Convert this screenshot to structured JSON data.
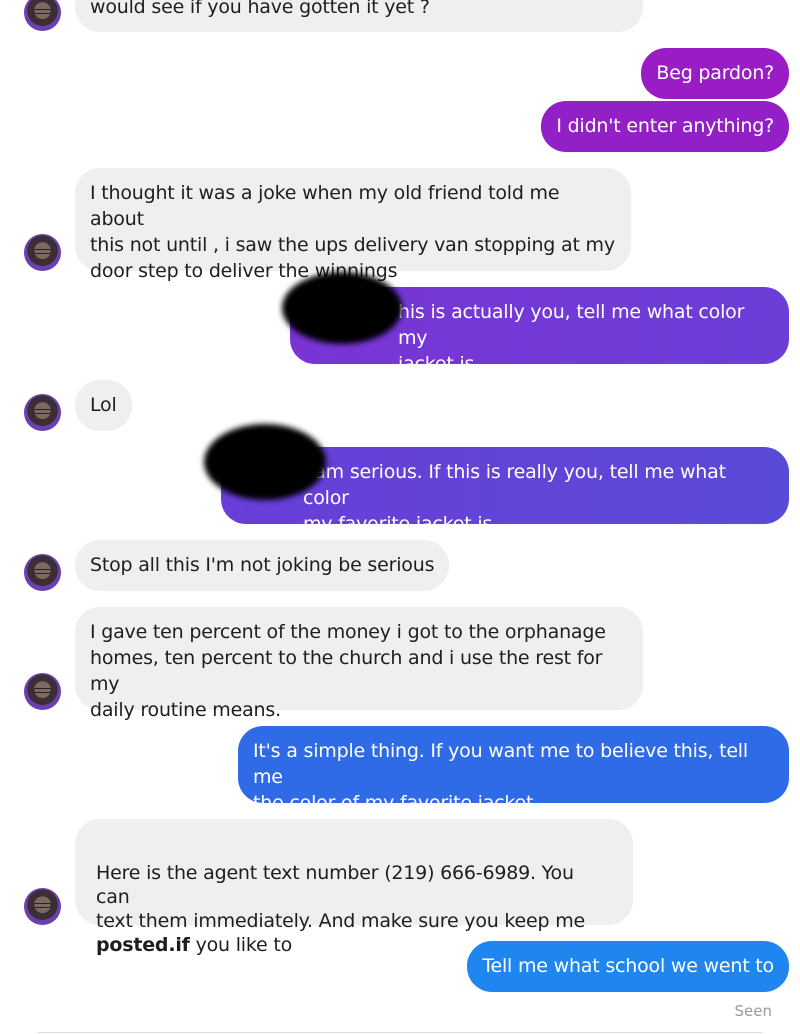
{
  "conversation": {
    "messages": [
      {
        "from": "them",
        "text": "would see if you have gotten it yet ?"
      },
      {
        "from": "me",
        "text": "Beg pardon?"
      },
      {
        "from": "me",
        "text": "I didn't enter anything?"
      },
      {
        "from": "them",
        "text": "I thought it was a joke when my old friend told me about\nthis not until , i saw the ups delivery van stopping at my\ndoor step to deliver the winnings"
      },
      {
        "from": "me",
        "text": "his is actually you, tell me what color my\njacket is."
      },
      {
        "from": "them",
        "text": "Lol"
      },
      {
        "from": "me",
        "text": "I am serious. If this is really you, tell me what color\nmy favorite jacket is."
      },
      {
        "from": "them",
        "text": "Stop all this I'm not joking be serious"
      },
      {
        "from": "them",
        "text": "I gave ten percent of the money i got to the orphanage\nhomes, ten percent to the church and i use the rest for my\ndaily routine means."
      },
      {
        "from": "me",
        "text": "It's a simple thing. If you want me to believe this, tell me\nthe color of my favorite jacket."
      },
      {
        "from": "them",
        "text_before": "Here is the agent text number (219) 666-6989. You can\ntext them immediately. And make sure you keep me\n",
        "text_bold": "posted.if",
        "text_after": " you like to"
      },
      {
        "from": "me",
        "text": "Tell me what school we went to"
      }
    ],
    "status": "Seen"
  },
  "colors": {
    "incoming_bubble": "#efeef0",
    "outgoing_purple": "#9a1cc4",
    "outgoing_violet": "#6c3bd8",
    "outgoing_blue": "#2f6be6",
    "outgoing_light_blue": "#1f86f0"
  }
}
